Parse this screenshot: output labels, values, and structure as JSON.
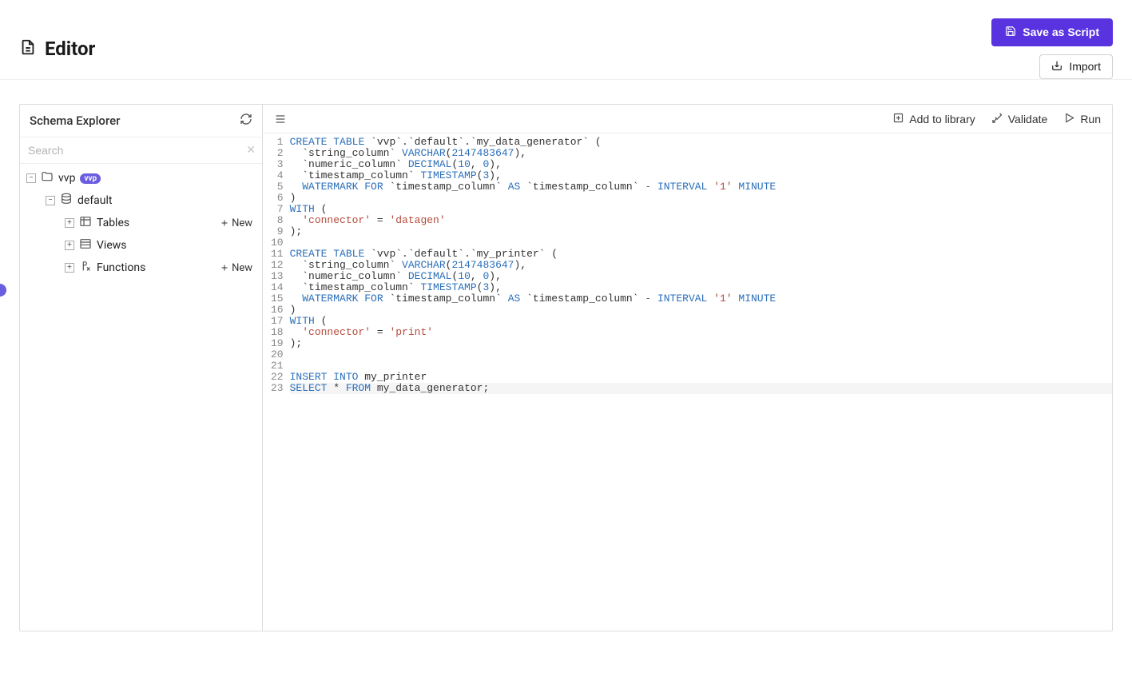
{
  "header": {
    "title": "Editor",
    "save_button": "Save as Script",
    "import_button": "Import"
  },
  "sidebar": {
    "title": "Schema Explorer",
    "search_placeholder": "Search",
    "new_label": "New",
    "tree": {
      "root": {
        "label": "vvp",
        "badge": "vvp"
      },
      "schema": {
        "label": "default"
      },
      "children": [
        {
          "label": "Tables",
          "has_new": true
        },
        {
          "label": "Views",
          "has_new": false
        },
        {
          "label": "Functions",
          "has_new": true
        }
      ]
    }
  },
  "toolbar": {
    "add_to_library": "Add to library",
    "validate": "Validate",
    "run": "Run"
  },
  "editor": {
    "highlighted_line": 23,
    "lines": [
      [
        [
          "kw",
          "CREATE"
        ],
        [
          "",
          " "
        ],
        [
          "kw",
          "TABLE"
        ],
        [
          "",
          " `vvp`.`default`.`my_data_generator` ("
        ]
      ],
      [
        [
          "",
          "  `string_column` "
        ],
        [
          "type",
          "VARCHAR"
        ],
        [
          "",
          "("
        ],
        [
          "num",
          "2147483647"
        ],
        [
          "",
          "),"
        ]
      ],
      [
        [
          "",
          "  `numeric_column` "
        ],
        [
          "type",
          "DECIMAL"
        ],
        [
          "",
          "("
        ],
        [
          "num",
          "10"
        ],
        [
          "",
          ", "
        ],
        [
          "num",
          "0"
        ],
        [
          "",
          "),"
        ]
      ],
      [
        [
          "",
          "  `timestamp_column` "
        ],
        [
          "type",
          "TIMESTAMP"
        ],
        [
          "",
          "("
        ],
        [
          "num",
          "3"
        ],
        [
          "",
          "),"
        ]
      ],
      [
        [
          "",
          "  "
        ],
        [
          "kw",
          "WATERMARK"
        ],
        [
          "",
          " "
        ],
        [
          "kw",
          "FOR"
        ],
        [
          "",
          " `timestamp_column` "
        ],
        [
          "kw",
          "AS"
        ],
        [
          "",
          " `timestamp_column` "
        ],
        [
          "op",
          "-"
        ],
        [
          "",
          " "
        ],
        [
          "kw",
          "INTERVAL"
        ],
        [
          "",
          " "
        ],
        [
          "str",
          "'1'"
        ],
        [
          "",
          " "
        ],
        [
          "kw",
          "MINUTE"
        ]
      ],
      [
        [
          "",
          ")"
        ]
      ],
      [
        [
          "kw",
          "WITH"
        ],
        [
          "",
          " ("
        ]
      ],
      [
        [
          "",
          "  "
        ],
        [
          "str",
          "'connector'"
        ],
        [
          "",
          " = "
        ],
        [
          "str",
          "'datagen'"
        ]
      ],
      [
        [
          "",
          ");"
        ]
      ],
      [
        [
          "",
          ""
        ]
      ],
      [
        [
          "kw",
          "CREATE"
        ],
        [
          "",
          " "
        ],
        [
          "kw",
          "TABLE"
        ],
        [
          "",
          " `vvp`.`default`.`my_printer` ("
        ]
      ],
      [
        [
          "",
          "  `string_column` "
        ],
        [
          "type",
          "VARCHAR"
        ],
        [
          "",
          "("
        ],
        [
          "num",
          "2147483647"
        ],
        [
          "",
          "),"
        ]
      ],
      [
        [
          "",
          "  `numeric_column` "
        ],
        [
          "type",
          "DECIMAL"
        ],
        [
          "",
          "("
        ],
        [
          "num",
          "10"
        ],
        [
          "",
          ", "
        ],
        [
          "num",
          "0"
        ],
        [
          "",
          "),"
        ]
      ],
      [
        [
          "",
          "  `timestamp_column` "
        ],
        [
          "type",
          "TIMESTAMP"
        ],
        [
          "",
          "("
        ],
        [
          "num",
          "3"
        ],
        [
          "",
          "),"
        ]
      ],
      [
        [
          "",
          "  "
        ],
        [
          "kw",
          "WATERMARK"
        ],
        [
          "",
          " "
        ],
        [
          "kw",
          "FOR"
        ],
        [
          "",
          " `timestamp_column` "
        ],
        [
          "kw",
          "AS"
        ],
        [
          "",
          " `timestamp_column` "
        ],
        [
          "op",
          "-"
        ],
        [
          "",
          " "
        ],
        [
          "kw",
          "INTERVAL"
        ],
        [
          "",
          " "
        ],
        [
          "str",
          "'1'"
        ],
        [
          "",
          " "
        ],
        [
          "kw",
          "MINUTE"
        ]
      ],
      [
        [
          "",
          ")"
        ]
      ],
      [
        [
          "kw",
          "WITH"
        ],
        [
          "",
          " ("
        ]
      ],
      [
        [
          "",
          "  "
        ],
        [
          "str",
          "'connector'"
        ],
        [
          "",
          " = "
        ],
        [
          "str",
          "'print'"
        ]
      ],
      [
        [
          "",
          ");"
        ]
      ],
      [
        [
          "",
          ""
        ]
      ],
      [
        [
          "",
          ""
        ]
      ],
      [
        [
          "kw",
          "INSERT"
        ],
        [
          "",
          " "
        ],
        [
          "kw",
          "INTO"
        ],
        [
          "",
          " my_printer"
        ]
      ],
      [
        [
          "kw",
          "SELECT"
        ],
        [
          "",
          " * "
        ],
        [
          "kw",
          "FROM"
        ],
        [
          "",
          " my_data_generator;"
        ]
      ]
    ]
  }
}
